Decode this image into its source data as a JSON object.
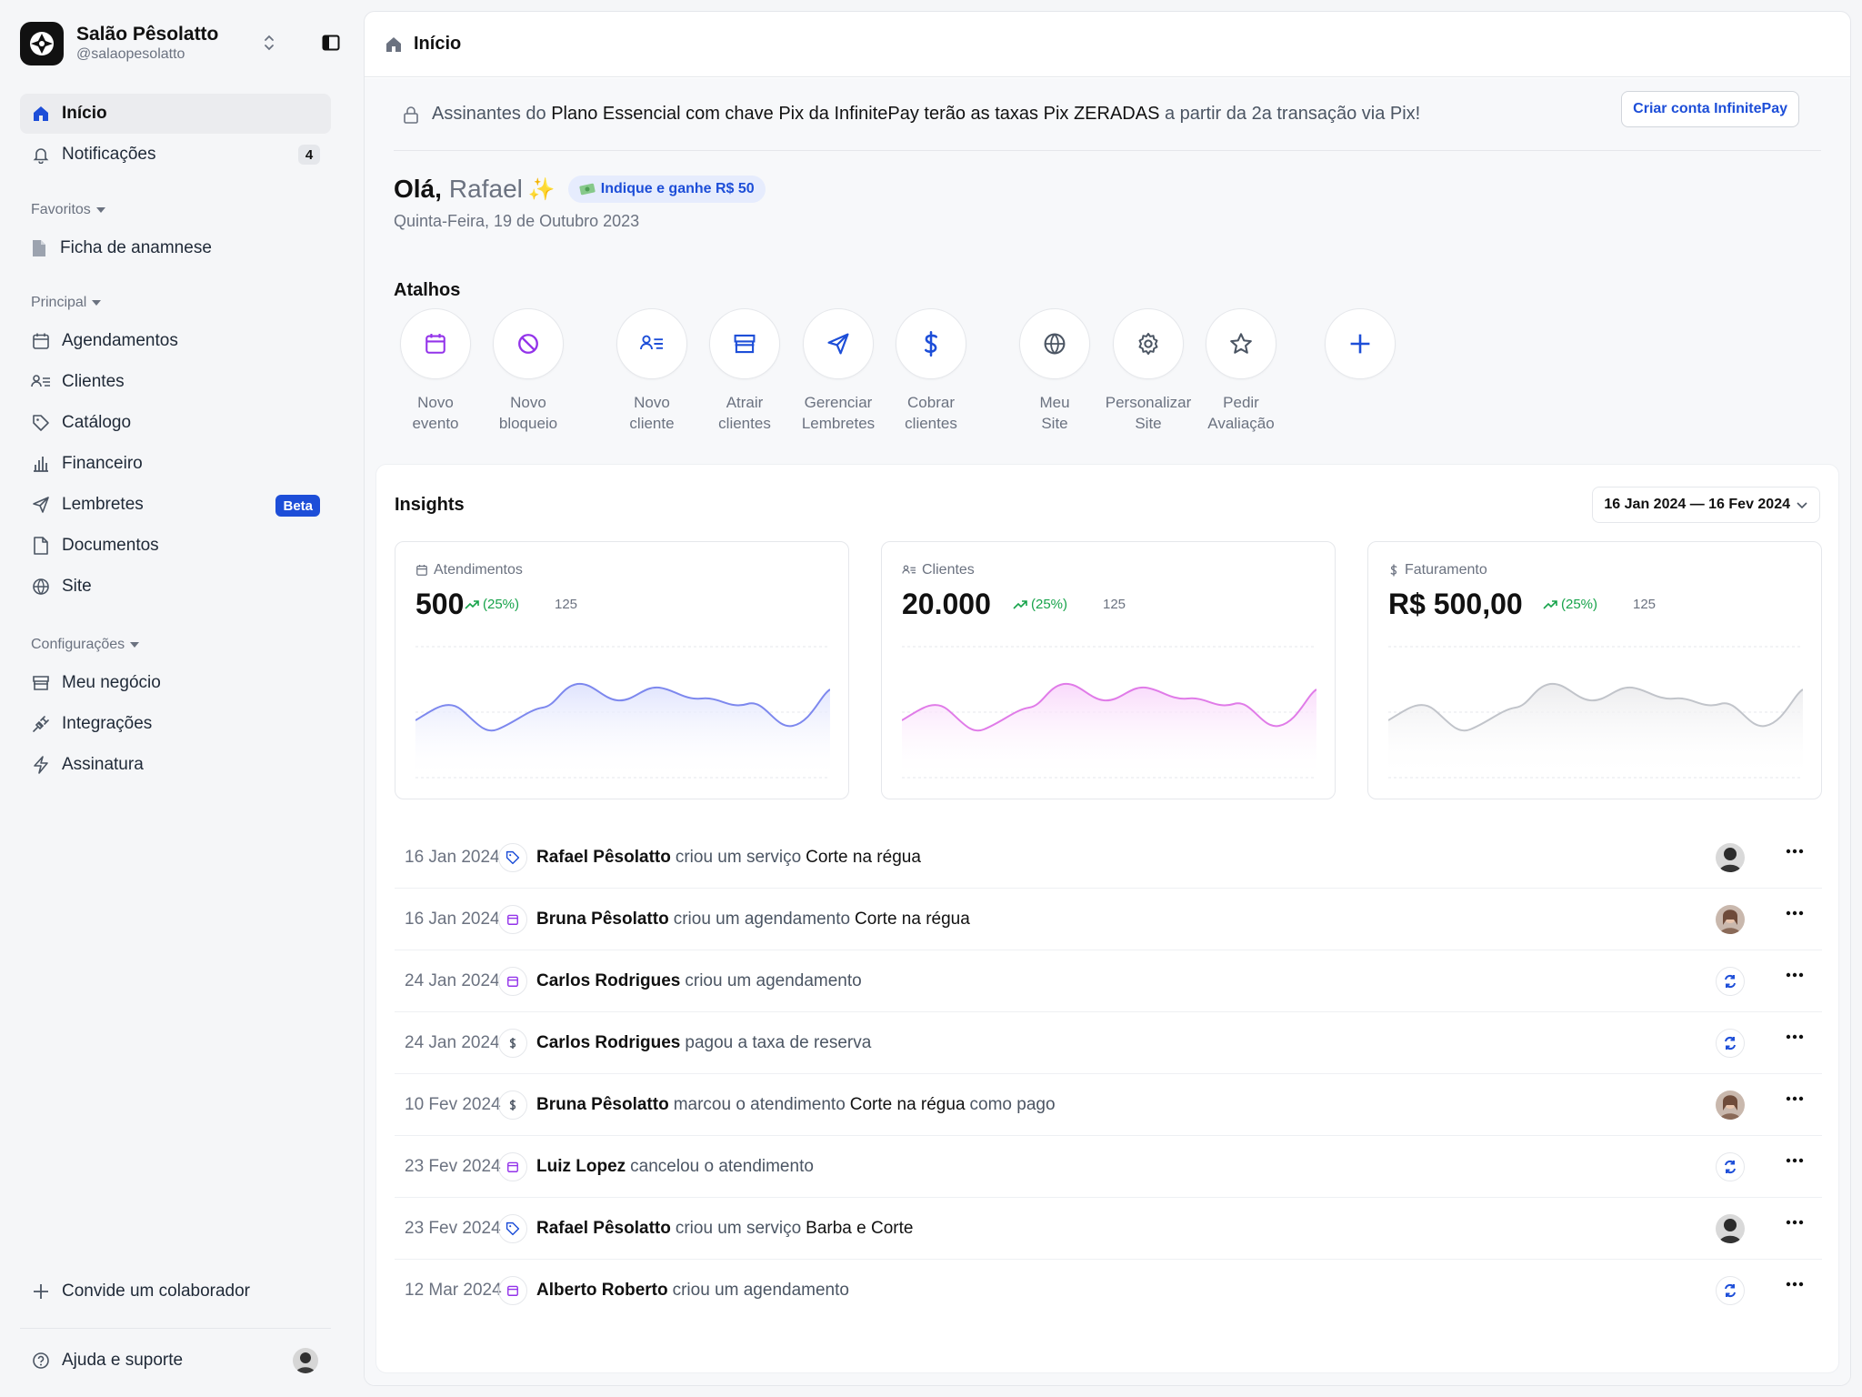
{
  "sidebar": {
    "brand": {
      "name": "Salão Pêsolatto",
      "handle": "@salaopesolatto"
    },
    "nav_top": [
      {
        "label": "Início",
        "icon": "home-icon",
        "active": true
      },
      {
        "label": "Notificações",
        "icon": "bell-icon",
        "count": "4"
      }
    ],
    "favorites": {
      "label": "Favoritos",
      "items": [
        {
          "label": "Ficha de anamnese",
          "icon": "document-icon"
        }
      ]
    },
    "principal": {
      "label": "Principal",
      "items": [
        {
          "label": "Agendamentos",
          "icon": "calendar-icon"
        },
        {
          "label": "Clientes",
          "icon": "users-list-icon"
        },
        {
          "label": "Catálogo",
          "icon": "tag-icon"
        },
        {
          "label": "Financeiro",
          "icon": "bar-chart-icon"
        },
        {
          "label": "Lembretes",
          "icon": "send-icon",
          "badge": "Beta"
        },
        {
          "label": "Documentos",
          "icon": "file-icon"
        },
        {
          "label": "Site",
          "icon": "globe-icon"
        }
      ]
    },
    "config": {
      "label": "Configurações",
      "items": [
        {
          "label": "Meu negócio",
          "icon": "store-icon"
        },
        {
          "label": "Integrações",
          "icon": "plug-icon"
        },
        {
          "label": "Assinatura",
          "icon": "bolt-icon"
        }
      ]
    },
    "invite_label": "Convide um colaborador",
    "help_label": "Ajuda e suporte"
  },
  "topbar": {
    "title": "Início"
  },
  "banner": {
    "prefix": "Assinantes do",
    "highlight": "Plano Essencial com chave Pix da InfinitePay terão as taxas Pix ZERADAS",
    "suffix": "a partir da 2a transação via Pix!",
    "button": "Criar conta InfinitePay"
  },
  "greeting": {
    "hello": "Olá,",
    "name": "Rafael",
    "spark": "✨",
    "referral": "Indique e ganhe R$ 50",
    "date": "Quinta-Feira, 19 de Outubro 2023"
  },
  "shortcuts": {
    "title": "Atalhos",
    "items": [
      {
        "label1": "Novo",
        "label2": "evento",
        "icon": "calendar-icon",
        "color": "#9333ea"
      },
      {
        "label1": "Novo",
        "label2": "bloqueio",
        "icon": "block-icon",
        "color": "#9333ea"
      },
      {
        "label1": "Novo",
        "label2": "cliente",
        "icon": "users-list-icon",
        "color": "#1d4ed8"
      },
      {
        "label1": "Atrair",
        "label2": "clientes",
        "icon": "store-icon",
        "color": "#1d4ed8"
      },
      {
        "label1": "Gerenciar",
        "label2": "Lembretes",
        "icon": "send-icon",
        "color": "#1d4ed8"
      },
      {
        "label1": "Cobrar",
        "label2": "clientes",
        "icon": "dollar-icon",
        "color": "#1d4ed8"
      },
      {
        "label1": "Meu",
        "label2": "Site",
        "icon": "globe-icon",
        "color": "#4b5563"
      },
      {
        "label1": "Personalizar",
        "label2": "Site",
        "icon": "gear-icon",
        "color": "#4b5563"
      },
      {
        "label1": "Pedir",
        "label2": "Avaliação",
        "icon": "star-icon",
        "color": "#4b5563"
      },
      {
        "label1": "",
        "label2": "",
        "icon": "plus-icon",
        "color": "#1d4ed8"
      }
    ]
  },
  "insights": {
    "title": "Insights",
    "range": "16 Jan 2024 — 16 Fev 2024",
    "cards": [
      {
        "label": "Atendimentos",
        "icon": "calendar-icon",
        "value": "500",
        "trend": "(25%)",
        "base": "125",
        "color": "#6b7cf0",
        "fill": "#e6e9fd"
      },
      {
        "label": "Clientes",
        "icon": "users-list-icon",
        "value": "20.000",
        "trend": "(25%)",
        "base": "125",
        "color": "#e07be8",
        "fill": "#fbe6fb"
      },
      {
        "label": "Faturamento",
        "icon": "dollar-icon",
        "value": "R$ 500,00",
        "trend": "(25%)",
        "base": "125",
        "color": "#b9bcc2",
        "fill": "#f0f1f3"
      }
    ]
  },
  "activity": [
    {
      "date": "16 Jan 2024",
      "icon": "tag-icon",
      "icon_color": "#1d4ed8",
      "who": "Rafael Pêsolatto",
      "action": "criou um serviço",
      "object": "Corte na régua",
      "tail": "",
      "avatar": "avatar-man"
    },
    {
      "date": "16 Jan 2024",
      "icon": "calendar-icon",
      "icon_color": "#9333ea",
      "who": "Bruna Pêsolatto",
      "action": "criou um agendamento",
      "object": "Corte na régua",
      "tail": "",
      "avatar": "avatar-woman"
    },
    {
      "date": "24 Jan 2024",
      "icon": "calendar-icon",
      "icon_color": "#9333ea",
      "who": "Carlos Rodrigues",
      "action": "criou um agendamento",
      "object": "",
      "tail": "",
      "avatar": "sync"
    },
    {
      "date": "24 Jan 2024",
      "icon": "dollar-icon",
      "icon_color": "#4b5563",
      "who": "Carlos Rodrigues",
      "action": "pagou a taxa de reserva",
      "object": "",
      "tail": "",
      "avatar": "sync"
    },
    {
      "date": "10 Fev 2024",
      "icon": "dollar-icon",
      "icon_color": "#4b5563",
      "who": "Bruna Pêsolatto",
      "action": "marcou o atendimento",
      "object": "Corte na régua",
      "tail": "como pago",
      "avatar": "avatar-woman"
    },
    {
      "date": "23 Fev 2024",
      "icon": "calendar-icon",
      "icon_color": "#9333ea",
      "who": "Luiz Lopez",
      "action": "cancelou o atendimento",
      "object": "",
      "tail": "",
      "avatar": "sync"
    },
    {
      "date": "23 Fev 2024",
      "icon": "tag-icon",
      "icon_color": "#1d4ed8",
      "who": "Rafael Pêsolatto",
      "action": "criou um serviço",
      "object": "Barba e Corte",
      "tail": "",
      "avatar": "avatar-man"
    },
    {
      "date": "12 Mar 2024",
      "icon": "calendar-icon",
      "icon_color": "#9333ea",
      "who": "Alberto Roberto",
      "action": "criou um agendamento",
      "object": "",
      "tail": "",
      "avatar": "sync"
    }
  ]
}
